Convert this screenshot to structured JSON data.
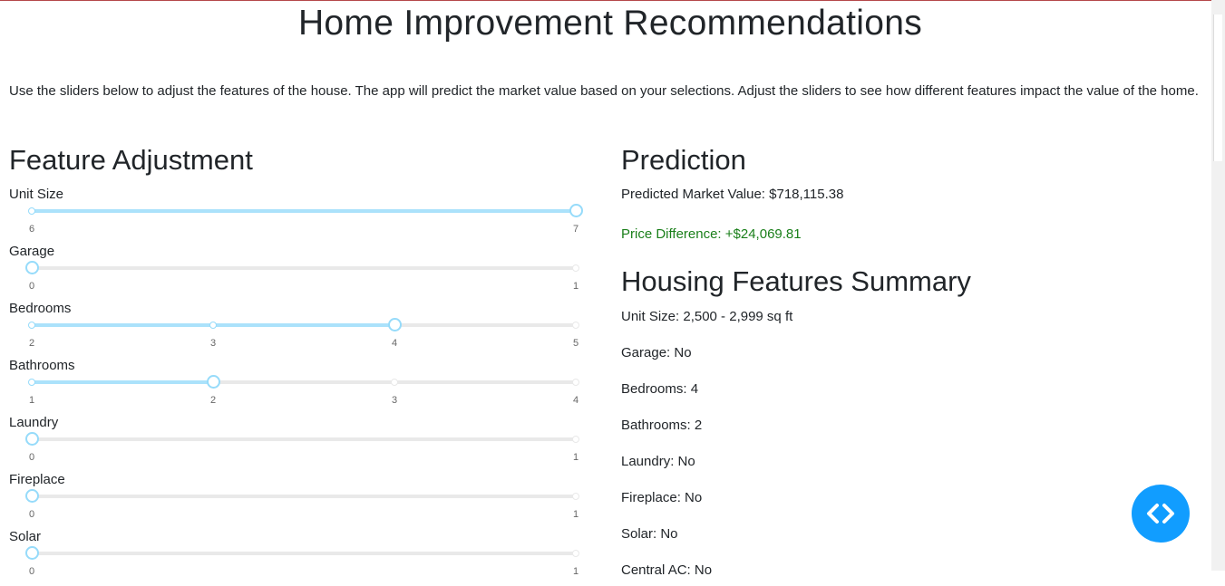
{
  "title": "Home Improvement Recommendations",
  "intro": "Use the sliders below to adjust the features of the house. The app will predict the market value based on your selections. Adjust the sliders to see how different features impact the value of the home.",
  "feature_adjustment": {
    "heading": "Feature Adjustment",
    "sliders": [
      {
        "label": "Unit Size",
        "min": 6,
        "max": 7,
        "value": 7,
        "marks": [
          "6",
          "7"
        ]
      },
      {
        "label": "Garage",
        "min": 0,
        "max": 1,
        "value": 0,
        "marks": [
          "0",
          "1"
        ]
      },
      {
        "label": "Bedrooms",
        "min": 2,
        "max": 5,
        "value": 4,
        "marks": [
          "2",
          "3",
          "4",
          "5"
        ]
      },
      {
        "label": "Bathrooms",
        "min": 1,
        "max": 4,
        "value": 2,
        "marks": [
          "1",
          "2",
          "3",
          "4"
        ]
      },
      {
        "label": "Laundry",
        "min": 0,
        "max": 1,
        "value": 0,
        "marks": [
          "0",
          "1"
        ]
      },
      {
        "label": "Fireplace",
        "min": 0,
        "max": 1,
        "value": 0,
        "marks": [
          "0",
          "1"
        ]
      },
      {
        "label": "Solar",
        "min": 0,
        "max": 1,
        "value": 0,
        "marks": [
          "0",
          "1"
        ]
      }
    ]
  },
  "prediction": {
    "heading": "Prediction",
    "market_value": "Predicted Market Value: $718,115.38",
    "price_difference": "Price Difference: +$24,069.81",
    "difference_color": "#1a7f1a"
  },
  "summary": {
    "heading": "Housing Features Summary",
    "items": [
      "Unit Size: 2,500 - 2,999 sq ft",
      "Garage: No",
      "Bedrooms: 4",
      "Bathrooms: 2",
      "Laundry: No",
      "Fireplace: No",
      "Solar: No",
      "Central AC: No"
    ]
  },
  "colors": {
    "accent": "#119dff",
    "slider_track": "#abe2fb",
    "slider_handle": "#96dbfa"
  },
  "fab_icon": "code-brackets-icon"
}
